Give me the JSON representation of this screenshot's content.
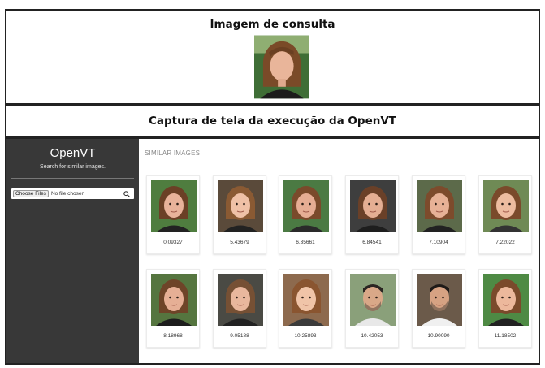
{
  "query_section": {
    "title": "Imagem de consulta"
  },
  "caption_section": {
    "title": "Captura de tela da execução da OpenVT"
  },
  "app": {
    "title": "OpenVT",
    "subtitle": "Search for similar images.",
    "upload": {
      "button_label": "Choose Files",
      "file_status": "No file chosen",
      "search_icon": "search-icon"
    }
  },
  "results": {
    "heading": "SIMILAR IMAGES",
    "items": [
      {
        "score": "0.09327"
      },
      {
        "score": "5.43679"
      },
      {
        "score": "6.35661"
      },
      {
        "score": "6.84541"
      },
      {
        "score": "7.10904"
      },
      {
        "score": "7.22022"
      },
      {
        "score": "8.18968"
      },
      {
        "score": "9.05188"
      },
      {
        "score": "10.25893"
      },
      {
        "score": "10.42053"
      },
      {
        "score": "10.90090"
      },
      {
        "score": "11.18502"
      }
    ]
  },
  "colors": {
    "sidebar": "#383838",
    "frame_border": "#222222",
    "heading_gray": "#8a8a8a"
  }
}
